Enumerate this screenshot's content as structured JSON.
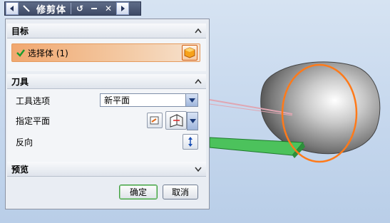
{
  "toolbar": {
    "back_icon": "left-arrow-icon",
    "title": "修剪体",
    "reset_icon": "reset-icon",
    "minimize_icon": "minimize-icon",
    "close_icon": "close-icon",
    "forward_icon": "right-arrow-icon"
  },
  "sections": {
    "target": {
      "title": "目标",
      "select_body_label": "选择体 (1)"
    },
    "tool": {
      "title": "刀具",
      "tool_option_label": "工具选项",
      "tool_option_value": "新平面",
      "specify_plane_label": "指定平面",
      "reverse_label": "反向"
    },
    "preview": {
      "title": "预览"
    }
  },
  "buttons": {
    "ok": "确定",
    "cancel": "取消"
  },
  "colors": {
    "accent_orange": "#f1a76f",
    "check_green": "#1b9b2e",
    "plane_green": "#33b24a",
    "section_orange": "#ff7a1a"
  }
}
